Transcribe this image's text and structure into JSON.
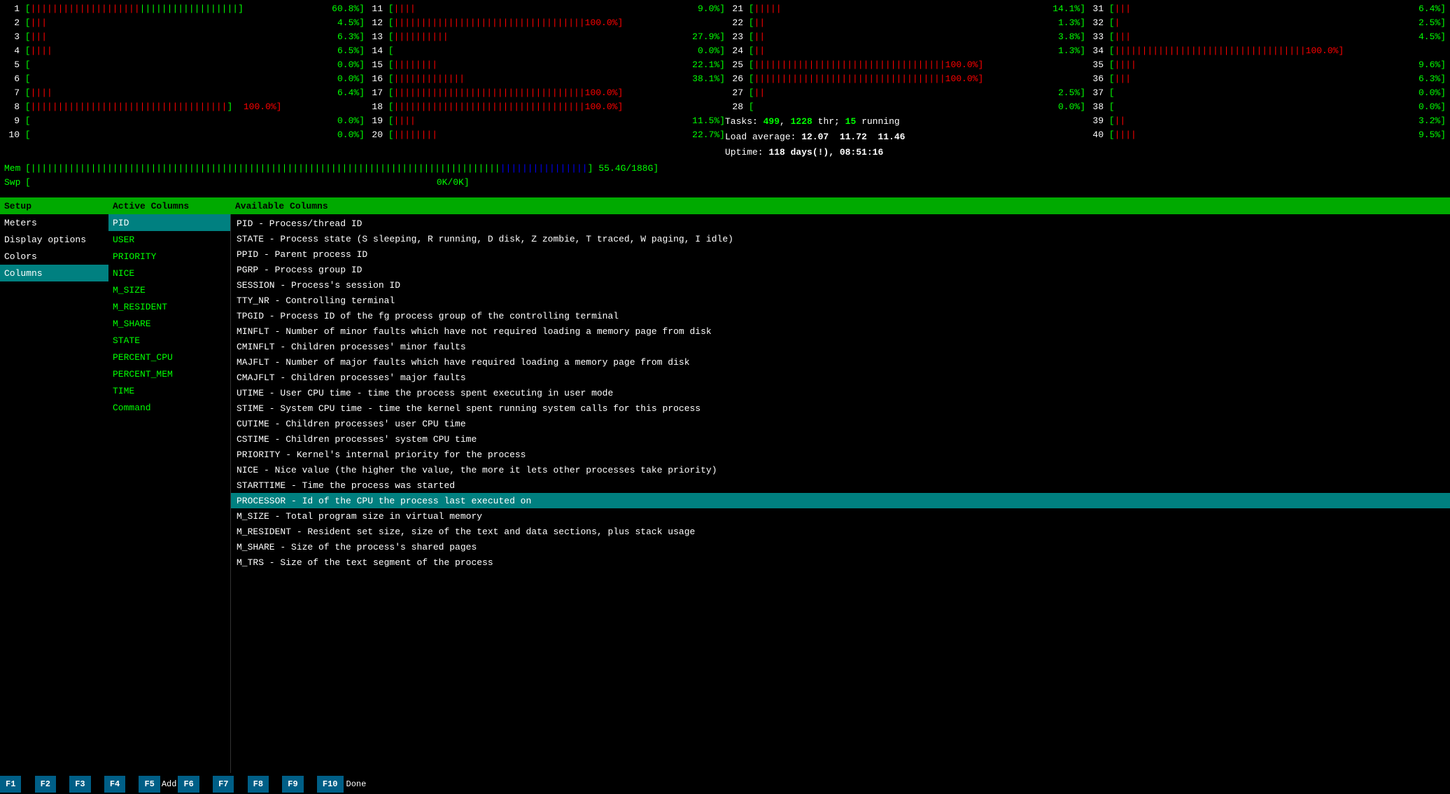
{
  "colors": {
    "green": "#00ff00",
    "red": "#ff0000",
    "black": "#000000",
    "white": "#ffffff",
    "teal": "#008080",
    "dark_green": "#00aa00",
    "blue_header": "#005f87"
  },
  "cpu_rows": [
    {
      "num": "1",
      "bar": "||||||||||||||||||||||||||||||||||||",
      "bar_type": "mixed",
      "pct": "60.8%"
    },
    {
      "num": "2",
      "bar": "|||",
      "bar_type": "red",
      "pct": "4.5%"
    },
    {
      "num": "3",
      "bar": "|||",
      "bar_type": "red",
      "pct": "6.3%"
    },
    {
      "num": "4",
      "bar": "||||",
      "bar_type": "red",
      "pct": "6.5%"
    },
    {
      "num": "5",
      "bar": "",
      "bar_type": "empty",
      "pct": "0.0%"
    },
    {
      "num": "6",
      "bar": "",
      "bar_type": "empty",
      "pct": "0.0%"
    },
    {
      "num": "7",
      "bar": "||||",
      "bar_type": "red",
      "pct": "6.4%"
    },
    {
      "num": "8",
      "bar": "||||||||||||||||||||||||||||||||||||",
      "bar_type": "mixed",
      "pct": "100.0%"
    },
    {
      "num": "9",
      "bar": "",
      "bar_type": "empty",
      "pct": "0.0%"
    },
    {
      "num": "10",
      "bar": "",
      "bar_type": "empty",
      "pct": "0.0%"
    }
  ],
  "tasks": {
    "label": "Tasks:",
    "count": "499",
    "thr_label": "thr;",
    "thr": "1228",
    "running_label": "running",
    "running": "15"
  },
  "load": {
    "label": "Load average:",
    "values": "12.07  11.72  11.46"
  },
  "uptime": {
    "label": "Uptime:",
    "value": "118 days(!), 08:51:16"
  },
  "mem": {
    "label": "Mem",
    "bar": "||||||||||||||||||||||||||||||||||||||||||||||||||||||||||||||||||||||||||||||||||||||||||||||||||||||||",
    "value": "55.4G/188G"
  },
  "swap": {
    "label": "Swp",
    "value": "0K/0K"
  },
  "setup": {
    "title": "Setup",
    "menu_items": [
      {
        "label": "Meters",
        "selected": false
      },
      {
        "label": "Display options",
        "selected": false
      },
      {
        "label": "Colors",
        "selected": false
      },
      {
        "label": "Columns",
        "selected": true
      }
    ]
  },
  "active_columns": {
    "title": "Active Columns",
    "items": [
      {
        "label": "PID",
        "selected": true
      },
      {
        "label": "USER"
      },
      {
        "label": "PRIORITY"
      },
      {
        "label": "NICE"
      },
      {
        "label": "M_SIZE"
      },
      {
        "label": "M_RESIDENT"
      },
      {
        "label": "M_SHARE"
      },
      {
        "label": "STATE"
      },
      {
        "label": "PERCENT_CPU"
      },
      {
        "label": "PERCENT_MEM"
      },
      {
        "label": "TIME"
      },
      {
        "label": "Command"
      }
    ]
  },
  "available_columns": {
    "title": "Available Columns",
    "items": [
      {
        "label": "PID - Process/thread ID",
        "highlighted": false
      },
      {
        "label": "STATE - Process state (S sleeping, R running, D disk, Z zombie, T traced, W paging, I idle)",
        "highlighted": false
      },
      {
        "label": "PPID - Parent process ID",
        "highlighted": false
      },
      {
        "label": "PGRP - Process group ID",
        "highlighted": false
      },
      {
        "label": "SESSION - Process's session ID",
        "highlighted": false
      },
      {
        "label": "TTY_NR - Controlling terminal",
        "highlighted": false
      },
      {
        "label": "TPGID - Process ID of the fg process group of the controlling terminal",
        "highlighted": false
      },
      {
        "label": "MINFLT - Number of minor faults which have not required loading a memory page from disk",
        "highlighted": false
      },
      {
        "label": "CMINFLT - Children processes' minor faults",
        "highlighted": false
      },
      {
        "label": "MAJFLT - Number of major faults which have required loading a memory page from disk",
        "highlighted": false
      },
      {
        "label": "CMAJFLT - Children processes' major faults",
        "highlighted": false
      },
      {
        "label": "UTIME - User CPU time - time the process spent executing in user mode",
        "highlighted": false
      },
      {
        "label": "STIME - System CPU time - time the kernel spent running system calls for this process",
        "highlighted": false
      },
      {
        "label": "CUTIME - Children processes' user CPU time",
        "highlighted": false
      },
      {
        "label": "CSTIME - Children processes' system CPU time",
        "highlighted": false
      },
      {
        "label": "PRIORITY - Kernel's internal priority for the process",
        "highlighted": false
      },
      {
        "label": "NICE - Nice value (the higher the value, the more it lets other processes take priority)",
        "highlighted": false
      },
      {
        "label": "STARTTIME - Time the process was started",
        "highlighted": false
      },
      {
        "label": "PROCESSOR - Id of the CPU the process last executed on",
        "highlighted": true
      },
      {
        "label": "M_SIZE - Total program size in virtual memory",
        "highlighted": false
      },
      {
        "label": "M_RESIDENT - Resident set size, size of the text and data sections, plus stack usage",
        "highlighted": false
      },
      {
        "label": "M_SHARE - Size of the process's shared pages",
        "highlighted": false
      },
      {
        "label": "M_TRS - Size of the text segment of the process",
        "highlighted": false
      }
    ]
  },
  "bottom_bar": {
    "keys": [
      {
        "fn": "F1",
        "label": ""
      },
      {
        "fn": "F2",
        "label": ""
      },
      {
        "fn": "F3",
        "label": ""
      },
      {
        "fn": "F4",
        "label": ""
      },
      {
        "fn": "F5",
        "label": "Add"
      },
      {
        "fn": "F6",
        "label": ""
      },
      {
        "fn": "F7",
        "label": ""
      },
      {
        "fn": "F8",
        "label": ""
      },
      {
        "fn": "F9",
        "label": ""
      },
      {
        "fn": "F10",
        "label": "Done"
      }
    ]
  }
}
